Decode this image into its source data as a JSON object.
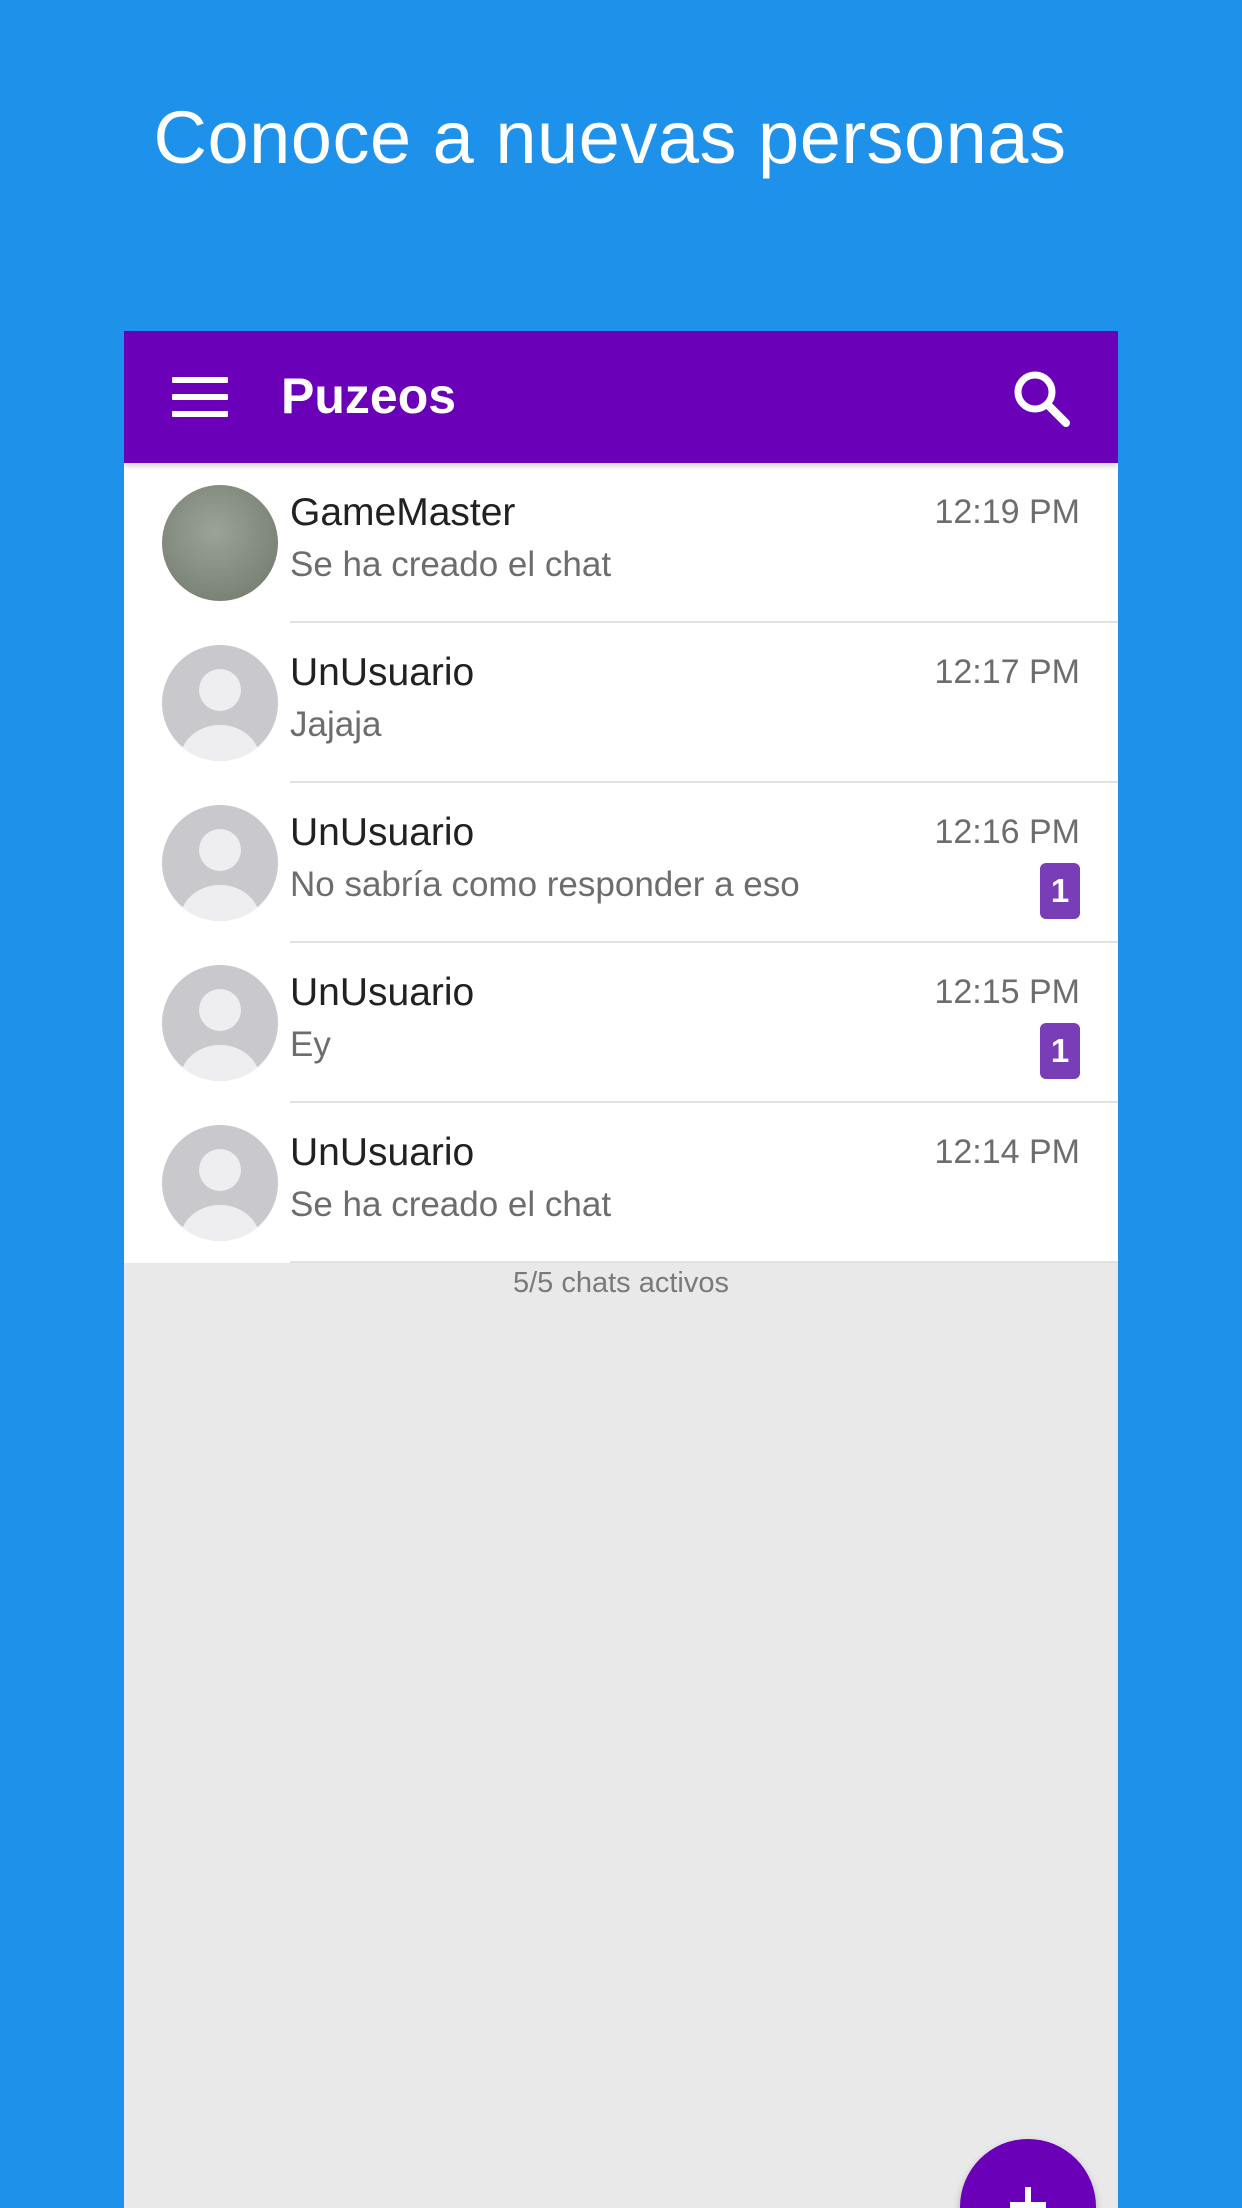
{
  "promo": {
    "title": "Conoce a nuevas personas"
  },
  "app_bar": {
    "title": "Puzeos",
    "menu_icon": "menu-icon",
    "search_icon": "search-icon"
  },
  "chats": [
    {
      "name": "GameMaster",
      "preview": "Se ha creado el chat",
      "time": "12:19 PM",
      "unread": null,
      "avatar": "photo"
    },
    {
      "name": "UnUsuario",
      "preview": "Jajaja",
      "time": "12:17 PM",
      "unread": null,
      "avatar": "default-person-icon"
    },
    {
      "name": "UnUsuario",
      "preview": "No sabría como responder a eso",
      "time": "12:16 PM",
      "unread": "1",
      "avatar": "default-person-icon"
    },
    {
      "name": "UnUsuario",
      "preview": "Ey",
      "time": "12:15 PM",
      "unread": "1",
      "avatar": "default-person-icon"
    },
    {
      "name": "UnUsuario",
      "preview": "Se ha creado el chat",
      "time": "12:14 PM",
      "unread": null,
      "avatar": "default-person-icon"
    }
  ],
  "footer": {
    "active_chats": "5/5 chats activos"
  },
  "fab": {
    "icon": "plus-icon"
  },
  "colors": {
    "background": "#1e91ea",
    "app_bar": "#6a00b8",
    "badge": "#7a3db8",
    "list_bg": "#ffffff",
    "screen_bg": "#e9e9e9"
  }
}
